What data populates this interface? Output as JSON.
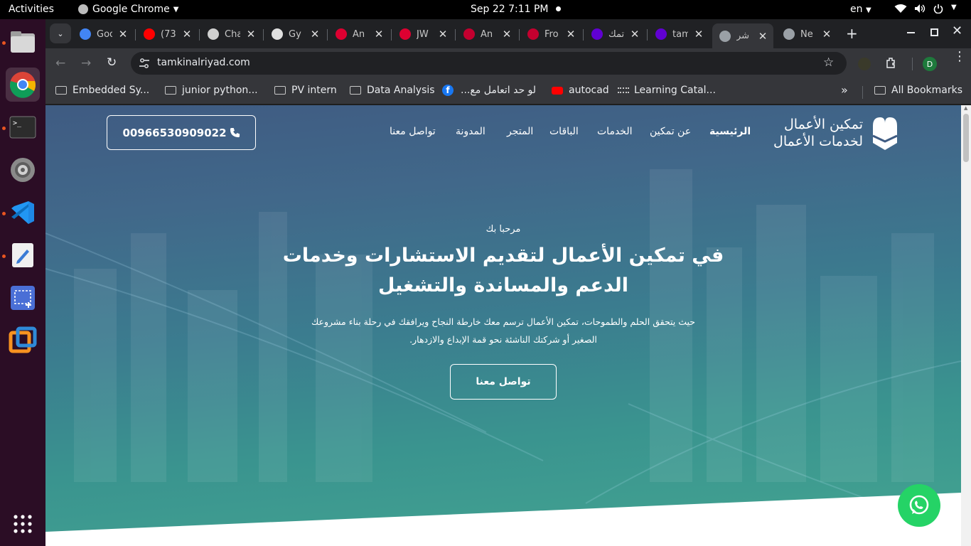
{
  "system_bar": {
    "activities": "Activities",
    "app_menu": "Google Chrome",
    "clock": "Sep 22  7:11 PM",
    "language": "en"
  },
  "dock": {
    "items": [
      "files-icon",
      "chrome-icon",
      "terminal-icon",
      "settings-icon",
      "vscode-icon",
      "text-editor-icon",
      "screenshot-icon",
      "virtualbox-icon"
    ],
    "apps_grid": "show-apps-icon"
  },
  "tabs": [
    {
      "title": "Goo",
      "favicon_color": "#4285f4"
    },
    {
      "title": "(73",
      "favicon_color": "#ff0000"
    },
    {
      "title": "Cha",
      "favicon_color": "#d0d0d0"
    },
    {
      "title": "Gy",
      "favicon_color": "#e0e0e0"
    },
    {
      "title": "An",
      "favicon_color": "#dd0031"
    },
    {
      "title": "JW",
      "favicon_color": "#dd0031"
    },
    {
      "title": "An",
      "favicon_color": "#c3002f"
    },
    {
      "title": "Fro",
      "favicon_color": "#c3002f"
    },
    {
      "title": "تمك",
      "favicon_color": "#6001d2"
    },
    {
      "title": "tam",
      "favicon_color": "#6001d2"
    },
    {
      "title": "شر",
      "favicon_color": "#9aa0a6"
    },
    {
      "title": "Ne",
      "favicon_color": "#9aa0a6"
    }
  ],
  "toolbar": {
    "url": "tamkinalriyad.com",
    "profile_initial": "D"
  },
  "bookmarks": {
    "items": [
      {
        "label": "Embedded Sy...",
        "icon": "folder-icon"
      },
      {
        "label": "junior python...",
        "icon": "folder-icon"
      },
      {
        "label": "PV intern",
        "icon": "folder-icon"
      },
      {
        "label": "Data Analysis",
        "icon": "folder-icon"
      },
      {
        "label": "لو حد اتعامل مع...",
        "icon": "facebook-icon"
      },
      {
        "label": "autocad",
        "icon": "youtube-icon"
      },
      {
        "label": "Learning Catal...",
        "icon": "cisco-icon"
      }
    ],
    "all": "All Bookmarks"
  },
  "site": {
    "logo": {
      "line1": "تمكين الأعمال",
      "line2": "لخدمات الأعمال"
    },
    "nav": [
      "الرئيسية",
      "عن تمكين",
      "الخدمات",
      "الباقات",
      "المتجر",
      "المدونة",
      "تواصل معنا"
    ],
    "phone": "00966530909022",
    "hero": {
      "welcome": "مرحبا بك",
      "title_line1": "في تمكين الأعمال لتقديم الاستشارات وخدمات",
      "title_line2": "الدعم والمساندة والتشغيل",
      "desc_line1": "حيث يتحقق الحلم والطموحات، تمكين الأعمال ترسم معك خارطة النجاح ويرافقك في رحلة بناء مشروعك",
      "desc_line2": "الصغير أو شركتك الناشئة نحو قمة الإبداع والازدهار.",
      "cta": "تواصل معنا"
    },
    "whatsapp_color": "#25d366"
  },
  "colors": {
    "accent": "#e95420",
    "hero_top": "#3f5b82",
    "hero_bottom": "#44a591"
  }
}
